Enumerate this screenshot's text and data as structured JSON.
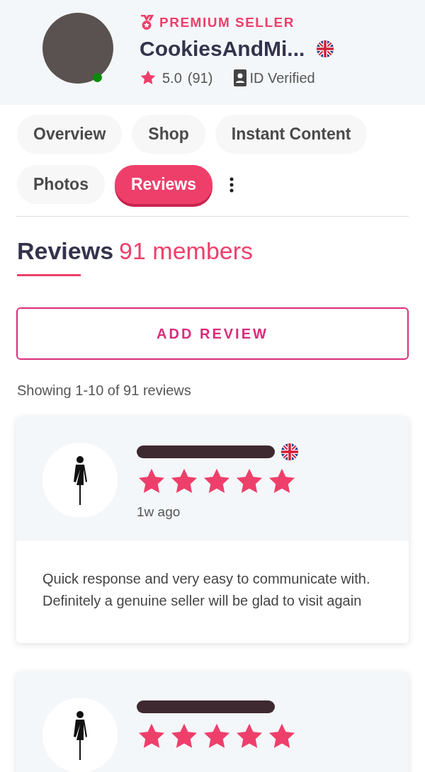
{
  "seller": {
    "badge": "PREMIUM SELLER",
    "name": "CookiesAndMi...",
    "online": true,
    "rating": "5.0",
    "rating_count": "(91)",
    "verified": "ID Verified"
  },
  "tabs": [
    {
      "label": "Overview",
      "selected": false
    },
    {
      "label": "Shop",
      "selected": false
    },
    {
      "label": "Instant Content",
      "selected": false
    },
    {
      "label": "Photos",
      "selected": false
    },
    {
      "label": "Reviews",
      "selected": true
    }
  ],
  "section": {
    "title": "Reviews",
    "count": "91 members"
  },
  "add_review": "ADD REVIEW",
  "showing": "Showing 1-10 of 91 reviews",
  "reviews": [
    {
      "has_flag": true,
      "stars": 5,
      "time": "1w ago",
      "text": "Quick response and very easy to communicate with. Definitely a genuine seller will be glad to visit again"
    },
    {
      "has_flag": false,
      "stars": 5
    }
  ]
}
